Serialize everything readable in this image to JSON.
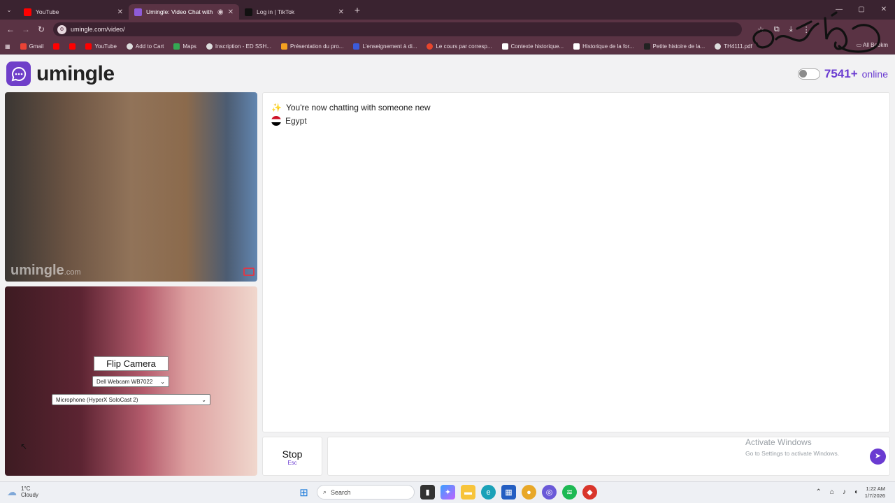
{
  "browser": {
    "tabs": [
      {
        "title": "YouTube",
        "active": false,
        "favicon_color": "#ff0000"
      },
      {
        "title": "Umingle: Video Chat with S",
        "active": true,
        "favicon_color": "#8e5bd8"
      },
      {
        "title": "Log in | TikTok",
        "active": false,
        "favicon_color": "#111111"
      }
    ],
    "address": "umingle.com/video/",
    "bookmarks": [
      {
        "label": "Gmail",
        "color": "#ea4335"
      },
      {
        "label": "",
        "color": "#ff0000"
      },
      {
        "label": "",
        "color": "#ff0000"
      },
      {
        "label": "YouTube",
        "color": "#ff0000"
      },
      {
        "label": "Add to Cart",
        "color": "#dddddd"
      },
      {
        "label": "Maps",
        "color": "#34a853"
      },
      {
        "label": "Inscription - ED SSH...",
        "color": "#dddddd"
      },
      {
        "label": "Présentation du pro...",
        "color": "#f4a020"
      },
      {
        "label": "L'enseignement à di...",
        "color": "#3b5bdb"
      },
      {
        "label": "Le cours par corresp...",
        "color": "#e8452c"
      },
      {
        "label": "Contexte historique...",
        "color": "#ffffff"
      },
      {
        "label": "Historique de la for...",
        "color": "#ffffff"
      },
      {
        "label": "Petite histoire de la...",
        "color": "#222222"
      },
      {
        "label": "TH4111.pdf",
        "color": "#dddddd"
      }
    ],
    "all_bookmarks": "All Bookm"
  },
  "site": {
    "logo_text": "umingle",
    "online_count": "7541+",
    "online_label": "online",
    "accent": "#6a3bd1"
  },
  "video": {
    "watermark": "umingle",
    "watermark_suffix": ".com",
    "flip_camera": "Flip Camera",
    "camera_select": "Dell Webcam WB7022",
    "mic_select": "Microphone (HyperX SoloCast 2)"
  },
  "chat": {
    "status": "You're now chatting with someone new",
    "status_icon": "sparkles-icon",
    "country": "Egypt"
  },
  "controls": {
    "stop_label": "Stop",
    "stop_shortcut": "Esc",
    "send_icon": "send-arrow-icon"
  },
  "activation": {
    "title": "Activate Windows",
    "subtitle": "Go to Settings to activate Windows."
  },
  "taskbar": {
    "temp": "1°C",
    "weather": "Cloudy",
    "search_placeholder": "Search",
    "time": "1:22 AM",
    "date": "1/7/2026"
  }
}
